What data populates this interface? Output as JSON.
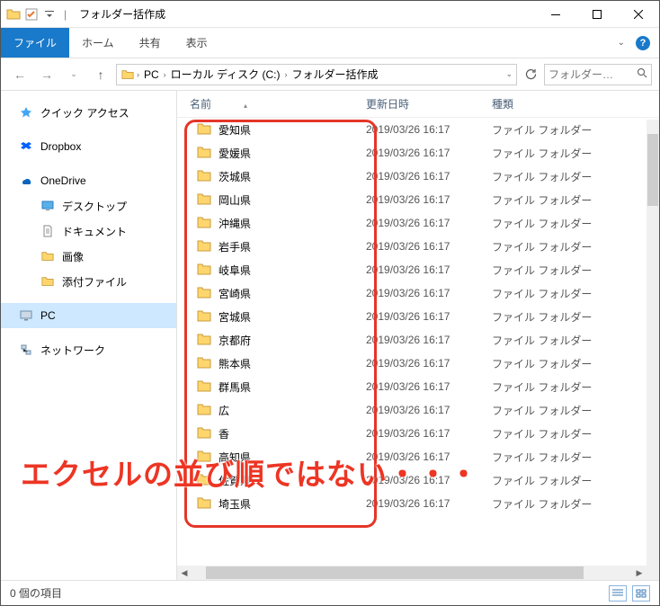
{
  "title": {
    "app": "フォルダー括作成",
    "qat_checked": true
  },
  "ribbon": {
    "file": "ファイル",
    "home": "ホーム",
    "share": "共有",
    "view": "表示"
  },
  "breadcrumb": {
    "pc": "PC",
    "drive": "ローカル ディスク (C:)",
    "folder": "フォルダー括作成"
  },
  "search": {
    "placeholder": "フォルダー…"
  },
  "nav": {
    "quick": "クイック アクセス",
    "dropbox": "Dropbox",
    "onedrive": "OneDrive",
    "desktop": "デスクトップ",
    "documents": "ドキュメント",
    "pictures": "画像",
    "attach": "添付ファイル",
    "pc": "PC",
    "network": "ネットワーク"
  },
  "cols": {
    "name": "名前",
    "date": "更新日時",
    "type": "種類"
  },
  "type_label": "ファイル フォルダー",
  "date_label": "2019/03/26 16:17",
  "rows": [
    "愛知県",
    "愛媛県",
    "茨城県",
    "岡山県",
    "沖縄県",
    "岩手県",
    "岐阜県",
    "宮崎県",
    "宮城県",
    "京都府",
    "熊本県",
    "群馬県",
    "広",
    "香",
    "高知県",
    "佐賀県",
    "埼玉県"
  ],
  "annotation": "エクセルの並び順ではない・・・",
  "status": "0 個の項目"
}
